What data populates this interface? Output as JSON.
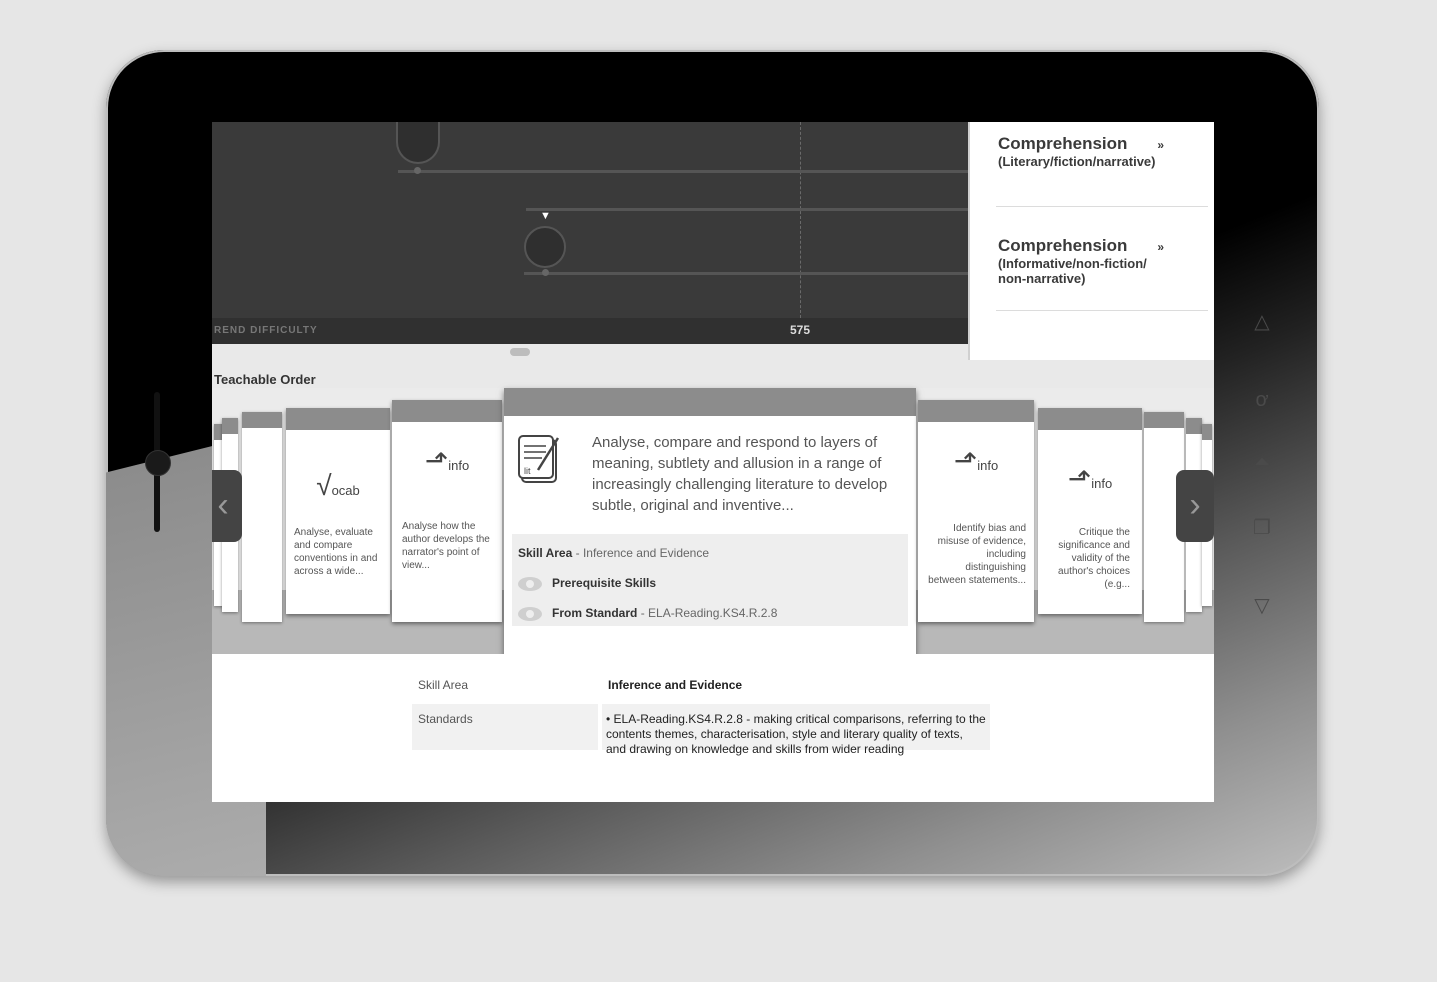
{
  "graph": {
    "axis_label": "REND DIFFICULTY",
    "axis_value": "575",
    "marker": "▼"
  },
  "right_panel": {
    "items": [
      {
        "title": "Comprehension",
        "chevron": "»",
        "subtitle": "(Literary/fiction/narrative)"
      },
      {
        "title": "Comprehension",
        "chevron": "»",
        "subtitle": "(Informative/non-fiction/ non-narrative)"
      }
    ]
  },
  "teachable_order": {
    "title": "Teachable Order",
    "cards": [
      {
        "icon": "vocab",
        "text": "Analyse, evaluate and compare conventions in and across a wide..."
      },
      {
        "icon": "info",
        "text": "Analyse how the author develops the narrator's point of view..."
      },
      {
        "icon": "info",
        "text": "Identify bias and misuse of evidence, including distinguishing between statements..."
      },
      {
        "icon": "info",
        "text": "Critique the significance and validity of the author's choices (e.g..."
      }
    ],
    "featured": {
      "icon": "lit",
      "description": "Analyse, compare and respond to layers of meaning, subtlety and allusion in a range of increasingly challenging literature to develop subtle, original and inventive...",
      "skill_area_label": "Skill Area",
      "skill_area_value": "- Inference and Evidence",
      "prerequisite_label": "Prerequisite Skills",
      "from_standard_label": "From Standard",
      "from_standard_value": "- ELA-Reading.KS4.R.2.8"
    },
    "nav_prev": "‹",
    "nav_next": "›"
  },
  "details": {
    "skill_area_label": "Skill Area",
    "skill_area_value": "Inference and Evidence",
    "standards_label": "Standards",
    "standards_value": "• ELA-Reading.KS4.R.2.8 - making critical comparisons, referring to the contents themes, characterisation, style and literary quality of texts, and drawing on knowledge and skills from wider reading"
  },
  "device": {
    "side_icons": [
      "triangle-up-icon",
      "search-icon",
      "plug-icon",
      "copy-icon",
      "triangle-down-icon"
    ]
  }
}
